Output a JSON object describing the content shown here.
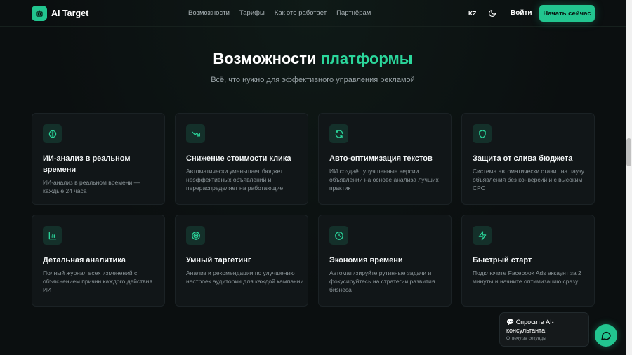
{
  "header": {
    "logo_text": "AI Target",
    "nav": [
      "Возможности",
      "Тарифы",
      "Как это работает",
      "Партнёрам"
    ],
    "lang": "KZ",
    "login_label": "Войти",
    "cta_label": "Начать сейчас"
  },
  "section": {
    "title_main": "Возможности ",
    "title_accent": "платформы",
    "subtitle": "Всё, что нужно для эффективного управления рекламой"
  },
  "features": [
    {
      "icon": "brain-icon",
      "title": "ИИ-анализ в реальном времени",
      "desc": "ИИ-анализ в реальном времени — каждые 24 часа"
    },
    {
      "icon": "trending-down-icon",
      "title": "Снижение стоимости клика",
      "desc": "Автоматически уменьшает бюджет неэффективных объявлений и перераспределяет на работающие"
    },
    {
      "icon": "refresh-icon",
      "title": "Авто-оптимизация текстов",
      "desc": "ИИ создаёт улучшенные версии объявлений на основе анализа лучших практик"
    },
    {
      "icon": "shield-icon",
      "title": "Защита от слива бюджета",
      "desc": "Система автоматически ставит на паузу объявления без конверсий и с высоким CPC"
    },
    {
      "icon": "bar-chart-icon",
      "title": "Детальная аналитика",
      "desc": "Полный журнал всех изменений с объяснением причин каждого действия ИИ"
    },
    {
      "icon": "target-icon",
      "title": "Умный таргетинг",
      "desc": "Анализ и рекомендации по улучшению настроек аудитории для каждой кампании"
    },
    {
      "icon": "clock-icon",
      "title": "Экономия времени",
      "desc": "Автоматизируйте рутинные задачи и фокусируйтесь на стратегии развития бизнеса"
    },
    {
      "icon": "lightning-icon",
      "title": "Быстрый старт",
      "desc": "Подключите Facebook Ads аккаунт за 2 минуты и начните оптимизацию сразу"
    }
  ],
  "chat": {
    "message": "💬 Спросите AI-консультанта!",
    "subtext": "Отвечу за секунды"
  },
  "colors": {
    "accent": "#22c58f",
    "background": "#0b0f10",
    "card": "#111618"
  }
}
